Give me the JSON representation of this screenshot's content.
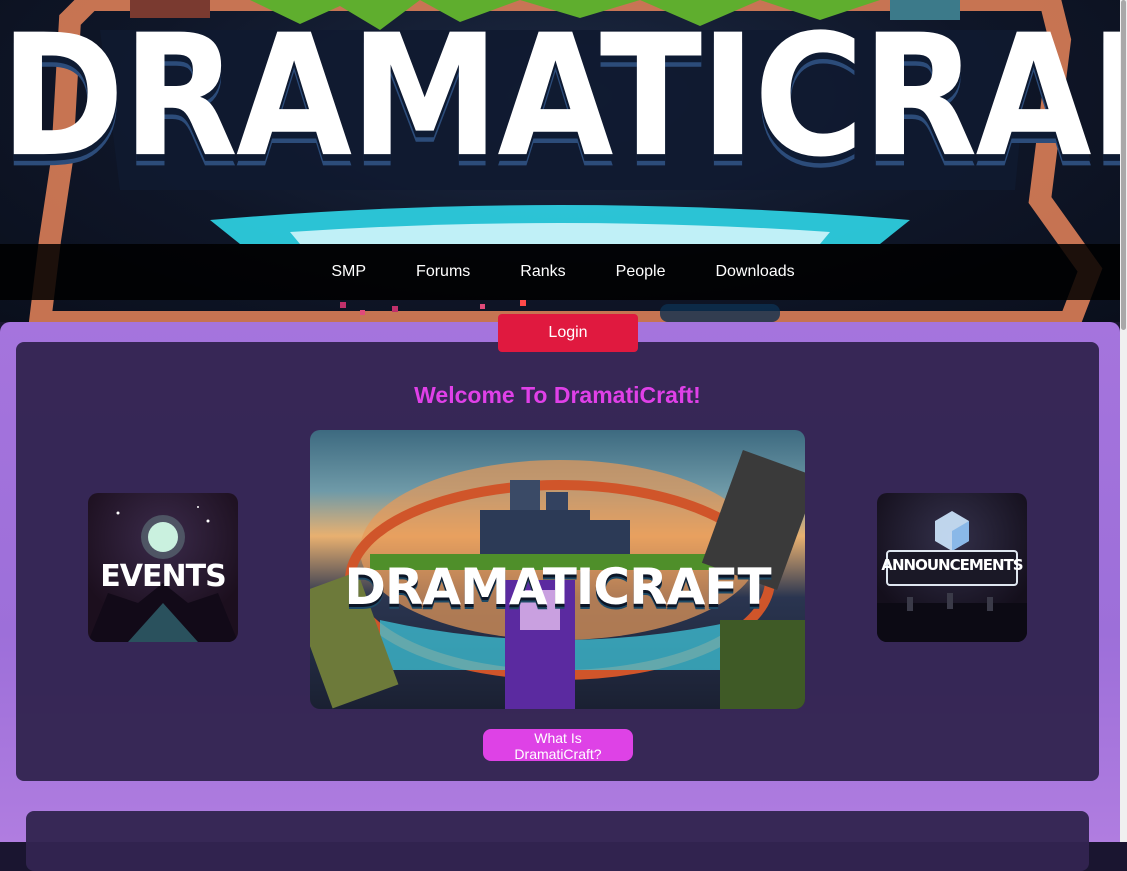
{
  "banner": {
    "title": "DRAMATICRAFT"
  },
  "nav": {
    "items": [
      {
        "label": "SMP"
      },
      {
        "label": "Forums"
      },
      {
        "label": "Ranks"
      },
      {
        "label": "People"
      },
      {
        "label": "Downloads"
      }
    ],
    "login_label": "Login"
  },
  "main": {
    "welcome": "Welcome To DramatiCraft!",
    "events_tile_label": "EVENTS",
    "announcements_tile_label": "ANNOUNCEMENTS",
    "hero_title": "DRAMATICRAFT",
    "what_button_label": "What Is DramatiCraft?"
  },
  "colors": {
    "login": "#e0193f",
    "welcome": "#e040e8",
    "what_button": "#de42e6",
    "page_bg": "#a574dd",
    "card_bg": "#322450"
  }
}
